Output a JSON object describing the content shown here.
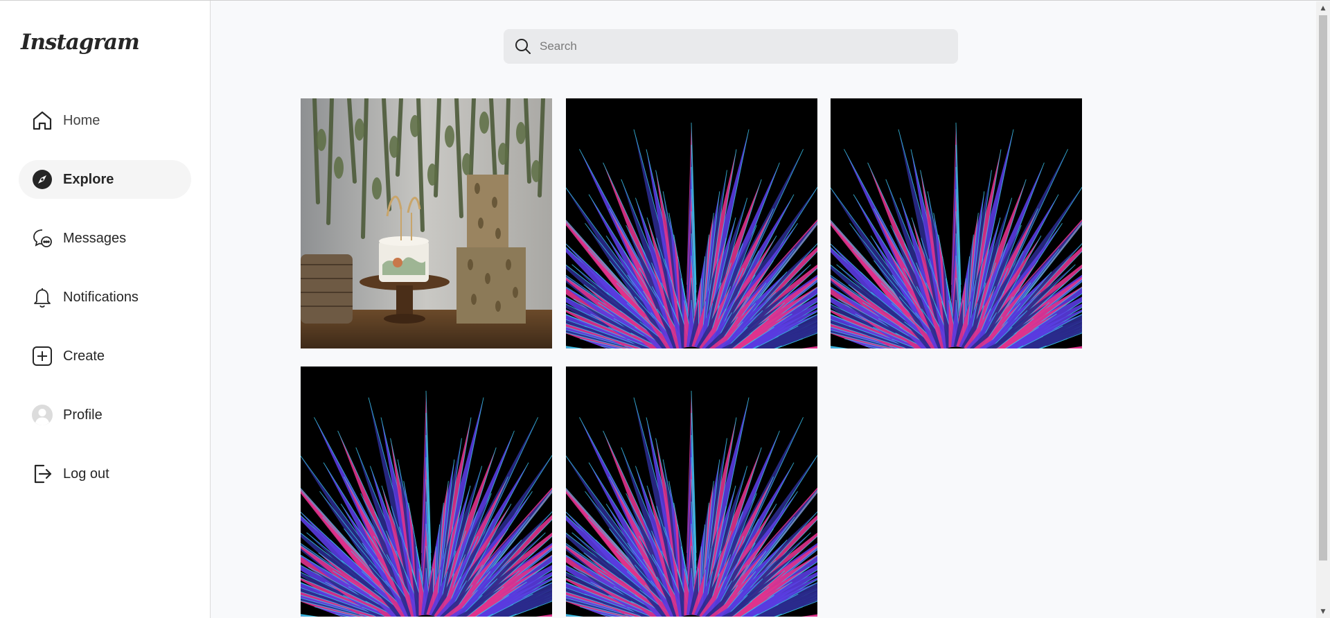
{
  "app": {
    "logo": "Instagram"
  },
  "sidebar": {
    "items": [
      {
        "key": "home",
        "label": "Home",
        "icon": "home-icon"
      },
      {
        "key": "explore",
        "label": "Explore",
        "icon": "compass-icon",
        "active": true
      },
      {
        "key": "messages",
        "label": "Messages",
        "icon": "chat-bubble-icon"
      },
      {
        "key": "notifications",
        "label": "Notifications",
        "icon": "bell-icon"
      },
      {
        "key": "create",
        "label": "Create",
        "icon": "plus-square-icon"
      },
      {
        "key": "profile",
        "label": "Profile",
        "icon": "avatar-icon"
      },
      {
        "key": "logout",
        "label": "Log out",
        "icon": "logout-icon"
      }
    ]
  },
  "search": {
    "placeholder": "Search",
    "value": ""
  },
  "explore_grid": {
    "posts": [
      {
        "image": "cake-party-photo"
      },
      {
        "image": "neon-spikes-art"
      },
      {
        "image": "neon-spikes-art"
      },
      {
        "image": "neon-spikes-art"
      },
      {
        "image": "neon-spikes-art"
      }
    ]
  },
  "colors": {
    "background": "#f8f9fb",
    "sidebar": "#ffffff",
    "active_nav": "#f5f5f5",
    "search_bg": "#e9eaec",
    "spike_pink": "#e0328c",
    "spike_cyan": "#38c8e8",
    "spike_violet": "#5a3be0"
  }
}
